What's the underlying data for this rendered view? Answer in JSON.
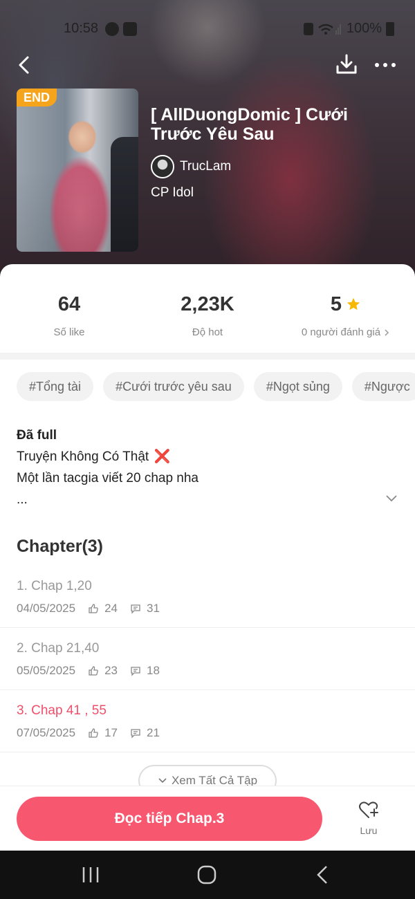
{
  "status_bar": {
    "time": "10:58",
    "battery": "100%"
  },
  "story": {
    "badge": "END",
    "title": "[ AllDuongDomic ] Cưới Trước Yêu Sau",
    "author": "TrucLam",
    "category": "CP Idol"
  },
  "stats": [
    {
      "value": "64",
      "label": "Số like"
    },
    {
      "value": "2,23K",
      "label": "Độ hot"
    },
    {
      "value": "5",
      "label": "0 người đánh giá"
    }
  ],
  "tags": [
    "#Tổng tài",
    "#Cưới trước yêu sau",
    "#Ngọt sủng",
    "#Ngược"
  ],
  "description": {
    "line1": "Đã full",
    "line2": "Truyện Không Có Thật",
    "line2_mark": "❌",
    "line3": "Một lần tacgia viết 20 chap nha",
    "line4": "..."
  },
  "chapters_heading": "Chapter(3)",
  "chapters": [
    {
      "title": "1. Chap 1,20",
      "date": "04/05/2025",
      "likes": "24",
      "comments": "31",
      "active": false
    },
    {
      "title": "2. Chap 21,40",
      "date": "05/05/2025",
      "likes": "23",
      "comments": "18",
      "active": false
    },
    {
      "title": "3. Chap 41 , 55",
      "date": "07/05/2025",
      "likes": "17",
      "comments": "21",
      "active": true
    }
  ],
  "see_all_label": "Xem Tất Cả Tập",
  "read_button_label": "Đọc tiếp Chap.3",
  "save_label": "Lưu",
  "colors": {
    "accent": "#f7586f",
    "active_chapter": "#ee4f6a",
    "badge": "#f5a41c",
    "star": "#f6b800"
  },
  "icons": [
    "back-icon",
    "download-icon",
    "more-icon",
    "star-icon",
    "chevron-right-icon",
    "chevron-down-icon",
    "like-icon",
    "comment-icon",
    "heart-plus-icon",
    "recents-icon",
    "home-icon",
    "nav-back-icon"
  ]
}
